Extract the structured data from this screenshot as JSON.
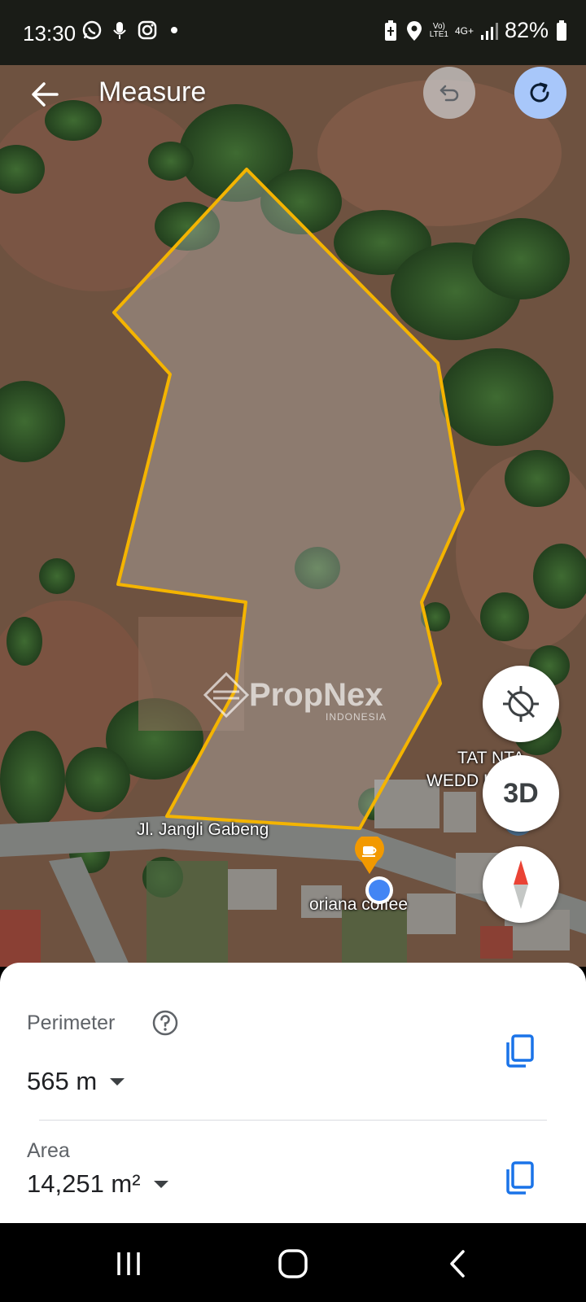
{
  "status_bar": {
    "time": "13:30",
    "network": "4G+",
    "carrier_line1": "Vo)",
    "carrier_line2": "LTE1",
    "battery": "82%",
    "left_icons": [
      "whatsapp-icon",
      "mic-icon",
      "instagram-icon",
      "dot-icon"
    ],
    "right_icons": [
      "battery-saver-icon",
      "location-icon",
      "volte-icon",
      "signal-icon",
      "battery-icon"
    ]
  },
  "header": {
    "title": "Measure",
    "back_icon": "arrow-back-icon",
    "undo_icon": "undo-icon",
    "redo_icon": "redo-icon"
  },
  "map": {
    "road_label": "Jl. Jangli Gabeng",
    "poi_label": "oriana coffee",
    "poi_icon": "coffee-cup-icon",
    "place_label_line1": "TAT        NTA",
    "place_label_line2": "WEDD            LLE",
    "watermark": "PropNex",
    "watermark_sub": "INDONESIA",
    "polygon_color": "#f4b400",
    "location_dot_color": "#4285f4",
    "location_button_icon": "location-disabled-icon",
    "view_3d_label": "3D",
    "compass_icon": "compass-icon"
  },
  "measure_sheet": {
    "perimeter_label": "Perimeter",
    "perimeter_value": "565 m",
    "area_label": "Area",
    "area_value": "14,251 m²",
    "help_icon": "help-circle-icon",
    "copy_icon": "copy-icon",
    "dropdown_icon": "dropdown-arrow-icon",
    "accent_color": "#1a73e8"
  },
  "nav_bar": {
    "recents_icon": "recents-icon",
    "home_icon": "home-icon",
    "back_icon": "back-chevron-icon"
  }
}
